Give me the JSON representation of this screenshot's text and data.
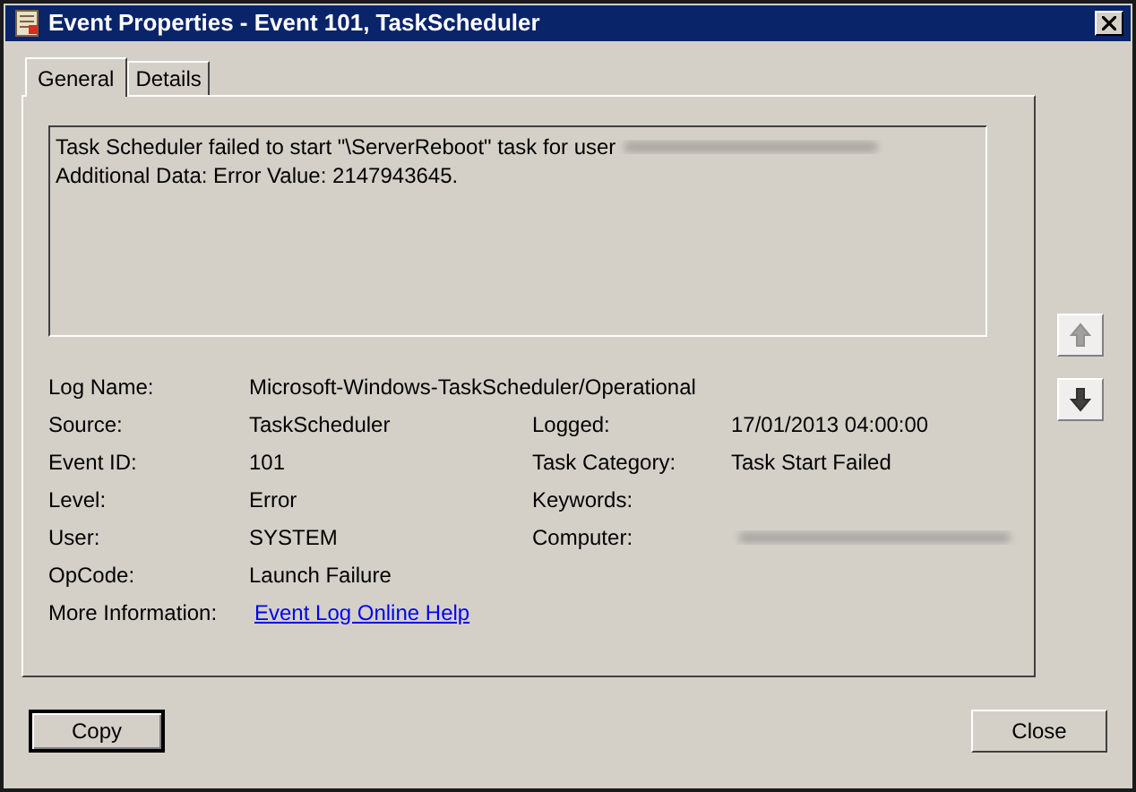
{
  "window": {
    "title": "Event Properties - Event 101, TaskScheduler"
  },
  "tabs": [
    {
      "label": "General",
      "selected": true
    },
    {
      "label": "Details",
      "selected": false
    }
  ],
  "message": {
    "lines": [
      "Task Scheduler failed to start \"\\ServerReboot\" task for user",
      "Additional Data: Error Value: 2147943645."
    ]
  },
  "fields": [
    {
      "label": "Log Name:",
      "value": "Microsoft-Windows-TaskScheduler/Operational",
      "kind": "wide"
    },
    {
      "label": "Source:",
      "value": "TaskScheduler",
      "label_2": "Logged:",
      "value_2": "17/01/2013 04:00:00",
      "kind": "pair"
    },
    {
      "label": "Event ID:",
      "value": "101",
      "label_2": "Task Category:",
      "value_2": "Task Start Failed",
      "kind": "pair"
    },
    {
      "label": "Level:",
      "value": "Error",
      "label_2": "Keywords:",
      "kind": "pair"
    },
    {
      "label": "User:",
      "value": "SYSTEM",
      "label_2": "Computer:",
      "kind": "pair-redacted"
    },
    {
      "label": "OpCode:",
      "value": "Launch Failure",
      "kind": "wide"
    },
    {
      "label": "More Information:",
      "value": "Event Log Online Help",
      "kind": "link"
    }
  ],
  "buttons": [
    "Copy",
    "Close"
  ]
}
